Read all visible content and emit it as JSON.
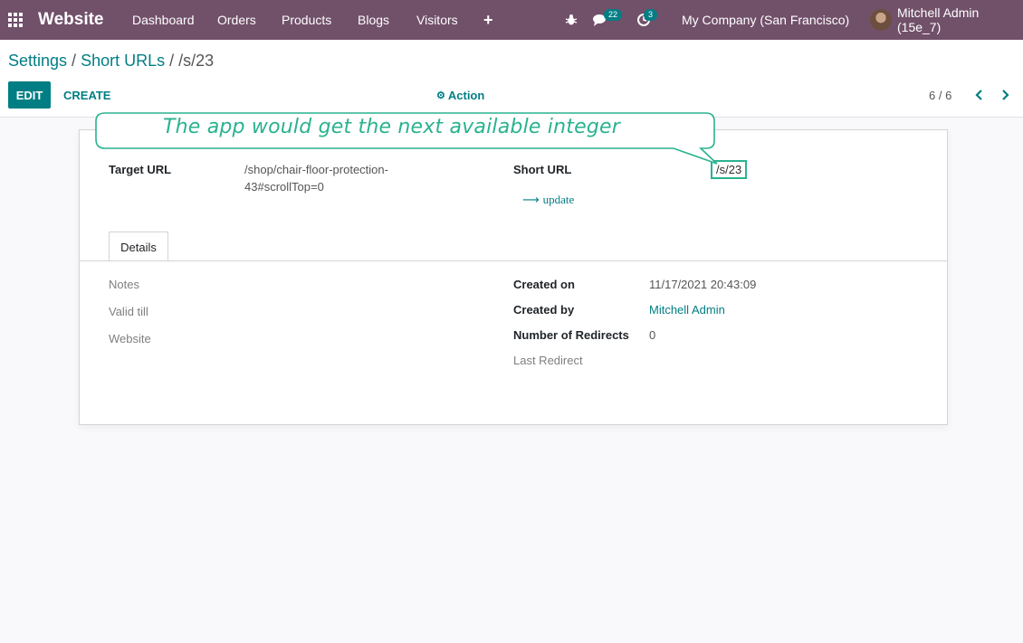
{
  "navbar": {
    "brand": "Website",
    "menu": [
      "Dashboard",
      "Orders",
      "Products",
      "Blogs",
      "Visitors"
    ],
    "add_icon": "plus-icon",
    "messages_count": "22",
    "activities_count": "3",
    "company": "My Company (San Francisco)",
    "user": "Mitchell Admin (15e_7)",
    "color": "#71506a"
  },
  "breadcrumb": {
    "settings": "Settings",
    "sep1": " / ",
    "short_urls": "Short URLs",
    "sep2": " / ",
    "current": "/s/23"
  },
  "toolbar": {
    "edit_label": "EDIT",
    "create_label": "CREATE",
    "action_label": "Action",
    "pager": "6 / 6"
  },
  "form": {
    "target_url_label": "Target URL",
    "target_url_line1": "/shop/chair-floor-protection-",
    "target_url_line2": "43#scrollTop=0",
    "short_url_label": "Short URL",
    "short_url_value": "/s/23",
    "update_label": "update",
    "tab_details": "Details",
    "notes_label": "Notes",
    "valid_till_label": "Valid till",
    "website_label": "Website",
    "created_on_label": "Created on",
    "created_on_value": "11/17/2021 20:43:09",
    "created_by_label": "Created by",
    "created_by_value": "Mitchell Admin",
    "redirects_label": "Number of Redirects",
    "redirects_value": "0",
    "last_redirect_label": "Last Redirect"
  },
  "annotation": {
    "text": "The app would get the next available integer",
    "color": "#2ab28f"
  },
  "colors": {
    "accent": "#017e84",
    "navbar": "#71506a"
  }
}
